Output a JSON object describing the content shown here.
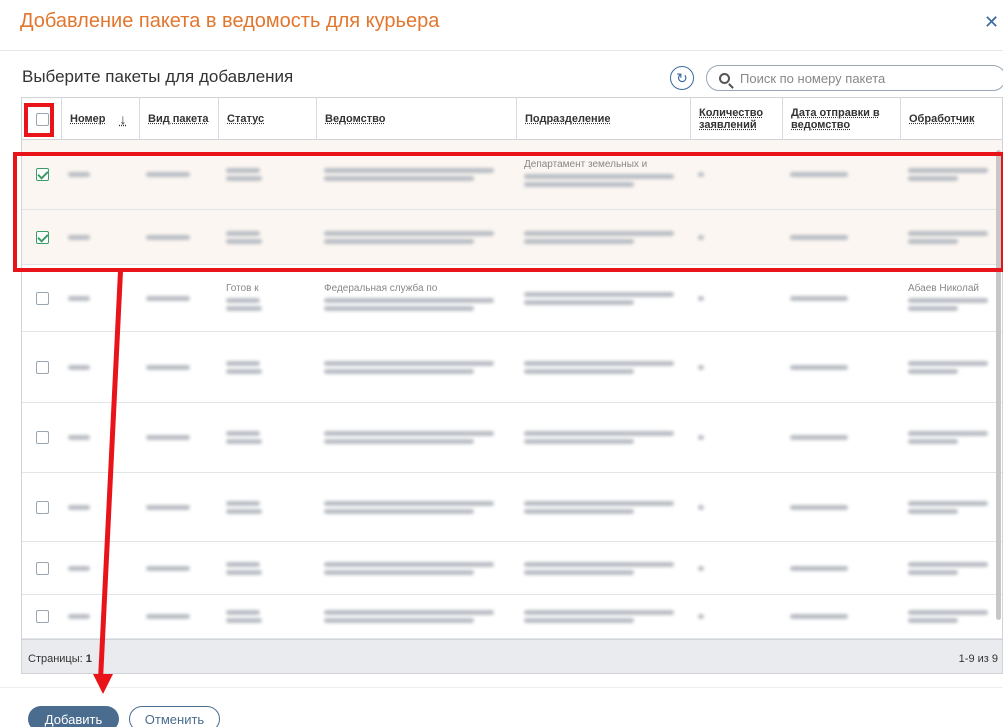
{
  "dialog": {
    "title": "Добавление пакета в ведомость для курьера",
    "close_icon": "close-icon"
  },
  "section": {
    "title": "Выберите пакеты для добавления"
  },
  "search": {
    "placeholder": "Поиск по номеру пакета",
    "value": ""
  },
  "table": {
    "columns": [
      "Номер",
      "Вид пакета",
      "Статус",
      "Ведомство",
      "Подразделение",
      "Количество заявлений",
      "Дата отправки в ведомство",
      "Обработчик"
    ],
    "sort_column": "Номер",
    "rows": [
      {
        "checked": true,
        "selected": true,
        "visible_text": {
          "department": "Департамент земельных и"
        }
      },
      {
        "checked": true,
        "selected": true
      },
      {
        "checked": false,
        "selected": false,
        "visible_text": {
          "status": "Готов к",
          "agency": "Федеральная служба по",
          "handler": "Абаев Николай"
        }
      },
      {
        "checked": false,
        "selected": false
      },
      {
        "checked": false,
        "selected": false
      },
      {
        "checked": false,
        "selected": false
      },
      {
        "checked": false,
        "selected": false
      },
      {
        "checked": false,
        "selected": false
      }
    ]
  },
  "footer": {
    "pages_label": "Страницы:",
    "pages_value": "1",
    "range": "1-9 из 9"
  },
  "actions": {
    "add_label": "Добавить",
    "cancel_label": "Отменить"
  },
  "colors": {
    "title": "#e2762e",
    "primary": "#4a6c8f",
    "annotation": "#e8141a",
    "check": "#3b9c67"
  }
}
